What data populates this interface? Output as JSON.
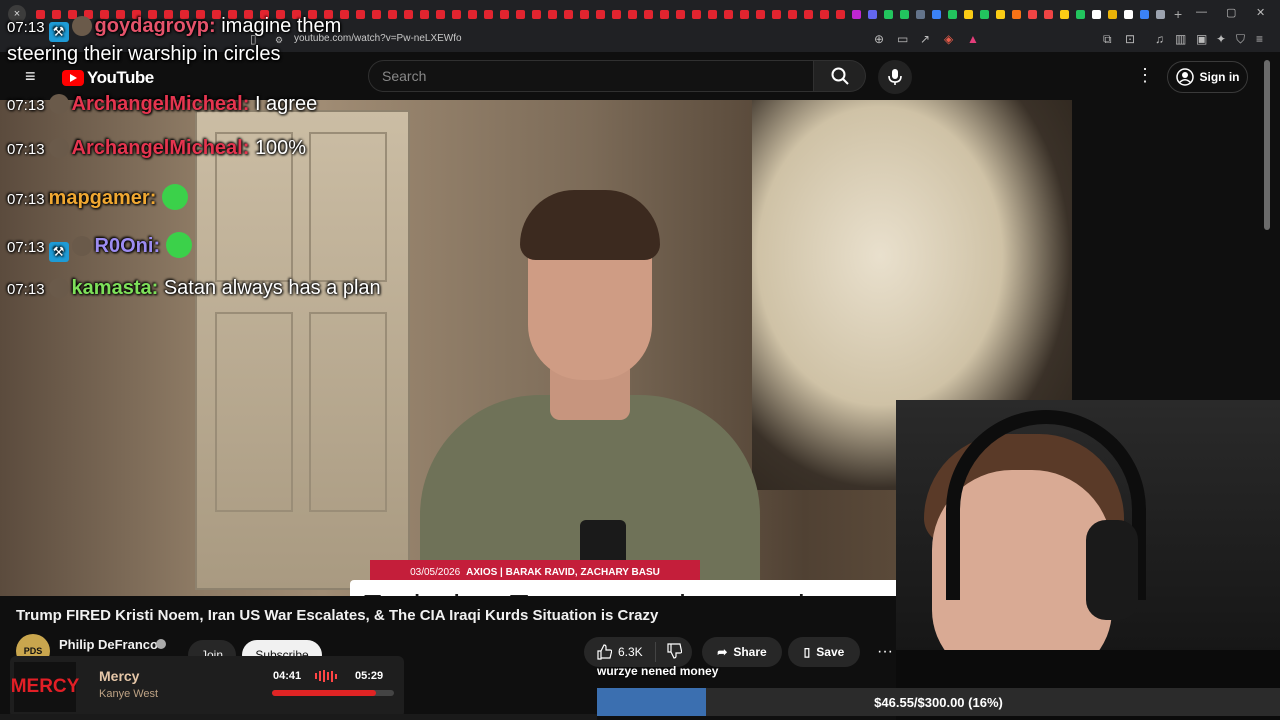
{
  "browser": {
    "tab_close_glyph": "×",
    "tab_colors": [
      "#e2242f",
      "#e2242f",
      "#e2242f",
      "#e2242f",
      "#e2242f",
      "#e2242f",
      "#e2242f",
      "#e2242f",
      "#e2242f",
      "#e2242f",
      "#e2242f",
      "#e2242f",
      "#e2242f",
      "#e2242f",
      "#e2242f",
      "#e2242f",
      "#e2242f",
      "#e2242f",
      "#e2242f",
      "#e2242f",
      "#e2242f",
      "#e2242f",
      "#e2242f",
      "#e2242f",
      "#e2242f",
      "#e2242f",
      "#e2242f",
      "#e2242f",
      "#e2242f",
      "#e2242f",
      "#e2242f",
      "#e2242f",
      "#e2242f",
      "#e2242f",
      "#e2242f",
      "#e2242f",
      "#e2242f",
      "#e2242f",
      "#e2242f",
      "#e2242f",
      "#e2242f",
      "#e2242f",
      "#e2242f",
      "#e2242f",
      "#e2242f",
      "#e2242f",
      "#e2242f",
      "#e2242f",
      "#e2242f",
      "#e2242f",
      "#e2242f",
      "#c026d3",
      "#6366f1",
      "#22c55e",
      "#22c55e",
      "#64748b",
      "#3b82f6",
      "#22c55e",
      "#facc15",
      "#22c55e",
      "#facc15",
      "#f97316",
      "#ef4444",
      "#ef4444",
      "#facc15",
      "#22c55e",
      "#ffffff",
      "#eab308",
      "#ffffff",
      "#3b82f6",
      "#9ca3af"
    ],
    "new_tab_glyph": "+",
    "url": "youtube.com/watch?v=Pw-neLXEWfo"
  },
  "youtube": {
    "logo_text": "YouTube",
    "search_placeholder": "Search",
    "sign_in": "Sign in",
    "video_title": "Trump FIRED Kristi Noem, Iran US War Escalates, & The CIA Iraqi Kurds Situation is Crazy",
    "channel_name": "Philip DeFranco",
    "avatar_text": "PDS",
    "join": "Join",
    "subscribe": "Subscribe",
    "likes": "6.3K",
    "share": "Share",
    "save": "Save",
    "brand_red": "#ff0000"
  },
  "video_overlay": {
    "date": "03/05/2026",
    "source": "AXIOS | BARAK RAVID, ZACHARY BASU",
    "headline": "Exclusive: Trump says he must be involved in picking Iran's next leader"
  },
  "chat": [
    {
      "time": "07:13",
      "user": "goydagroyp",
      "user_color": "#e5536b",
      "badges": [
        "mod",
        "sub"
      ],
      "message": "imagine them steering their warship in circles"
    },
    {
      "time": "07:13",
      "user": "ArchangelMicheal",
      "user_color": "#e5354f",
      "badges": [
        "sub"
      ],
      "message": "I agree"
    },
    {
      "time": "07:13",
      "user": "ArchangelMicheal",
      "user_color": "#e5354f",
      "badges": [
        "sub"
      ],
      "message": "100%"
    },
    {
      "time": "07:13",
      "user": "mapgamer",
      "user_color": "#f0a832",
      "badges": [],
      "message": "",
      "emote": "green-smile-emote"
    },
    {
      "time": "07:13",
      "user": "R0Oni",
      "user_color": "#9c8cf2",
      "badges": [
        "mod",
        "sub"
      ],
      "message": "",
      "emote": "green-smile-emote"
    },
    {
      "time": "07:13",
      "user": "kamasta",
      "user_color": "#7ee05a",
      "badges": [
        "sub"
      ],
      "message": "Satan always has a plan"
    }
  ],
  "now_playing": {
    "art_text": "MERCY",
    "title": "Mercy",
    "artist": "Kanye West",
    "elapsed": "04:41",
    "total": "05:29",
    "progress": 0.85
  },
  "donation": {
    "label": "wurzye nened money",
    "text": "$46.55/$300.00 (16%)",
    "progress": 0.16
  }
}
